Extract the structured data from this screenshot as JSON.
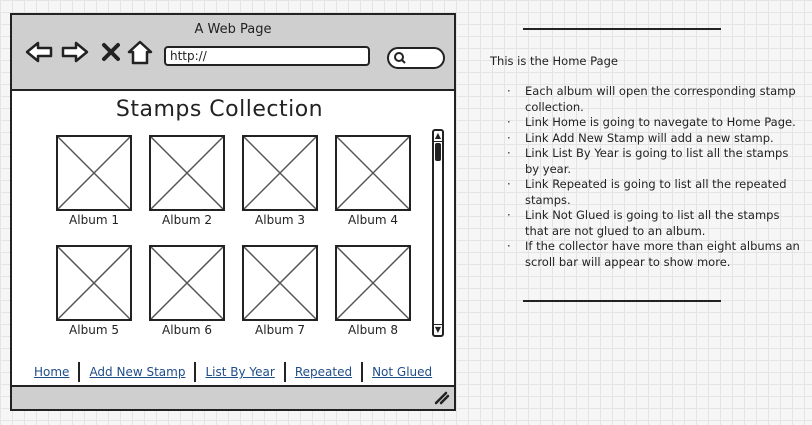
{
  "window": {
    "title": "A Web Page"
  },
  "toolbar": {
    "back_icon": "back-arrow-icon",
    "forward_icon": "forward-arrow-icon",
    "stop_icon": "close-icon",
    "home_icon": "home-icon",
    "url_value": "http://",
    "search_icon": "search-icon"
  },
  "page": {
    "title": "Stamps Collection",
    "albums": [
      {
        "label": "Album 1"
      },
      {
        "label": "Album 2"
      },
      {
        "label": "Album 3"
      },
      {
        "label": "Album 4"
      },
      {
        "label": "Album 5"
      },
      {
        "label": "Album 6"
      },
      {
        "label": "Album 7"
      },
      {
        "label": "Album 8"
      }
    ],
    "links": [
      {
        "label": "Home"
      },
      {
        "label": "Add New Stamp"
      },
      {
        "label": "List By Year"
      },
      {
        "label": "Repeated"
      },
      {
        "label": "Not Glued"
      }
    ]
  },
  "note": {
    "intro": "This is the Home Page",
    "items": [
      "Each album will open the corresponding stamp collection.",
      "Link Home is going to navegate to Home Page.",
      "Link Add New Stamp will add a new stamp.",
      "Link List By Year is going to list all the stamps by year.",
      "Link Repeated is going to list all the repeated stamps.",
      "Link Not Glued is going to list all the stamps that are not glued to an album.",
      "If the collector have more than eight albums an scroll bar will appear to show more."
    ]
  }
}
